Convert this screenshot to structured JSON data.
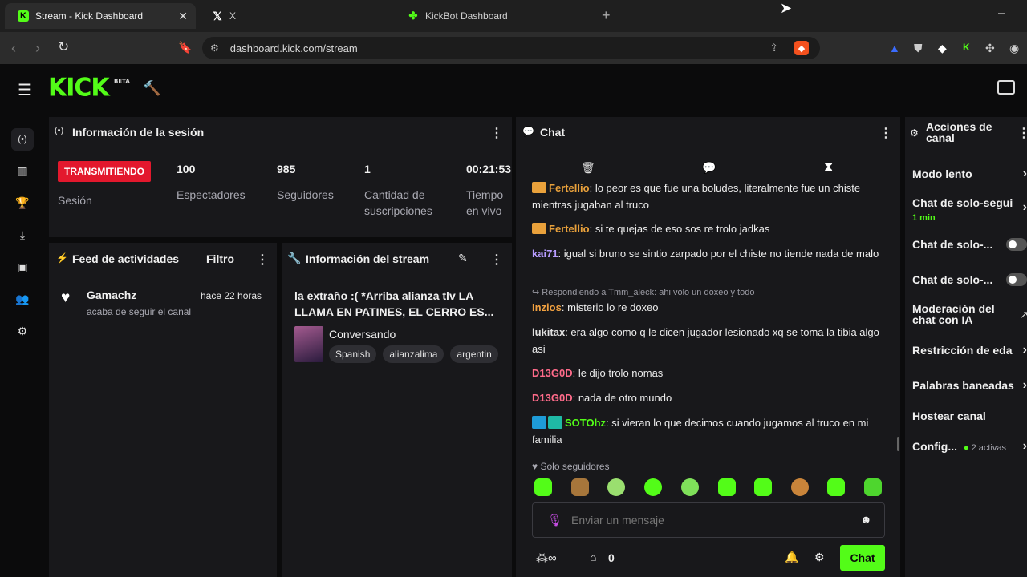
{
  "browser": {
    "tabs": [
      {
        "title": "Stream - Kick Dashboard",
        "icon": "kick-favicon"
      },
      {
        "title": "X",
        "icon": "x-favicon"
      },
      {
        "title": "KickBot Dashboard",
        "icon": "kickbot-favicon"
      }
    ],
    "new_tab": "+",
    "url": "dashboard.kick.com/stream",
    "minimize": "–"
  },
  "app": {
    "logo": "KICK",
    "logo_badge": "BETA"
  },
  "session": {
    "title": "Información de la sesión",
    "status_badge": "TRANSMITIENDO",
    "status_label": "Sesión",
    "stats": [
      {
        "value": "100",
        "label": "Espectadores"
      },
      {
        "value": "985",
        "label": "Seguidores"
      },
      {
        "value": "1",
        "label": "Cantidad de suscripciones"
      },
      {
        "value": "00:21:53",
        "label": "Tiempo en vivo"
      }
    ]
  },
  "feed": {
    "title": "Feed de actividades",
    "filter": "Filtro",
    "items": [
      {
        "user": "Gamachz",
        "time": "hace 22 horas",
        "text": "acaba de seguir el canal"
      }
    ]
  },
  "stream_info": {
    "title": "Información del stream",
    "stream_title": "la extraño :( *Arriba alianza tlv LA LLAMA EN PATINES, EL CERRO ES...",
    "category": "Conversando",
    "tags": [
      "Spanish",
      "alianzalima",
      "argentin"
    ]
  },
  "chat": {
    "title": "Chat",
    "messages": [
      {
        "user": "Fertellio",
        "color": "#e9a13b",
        "text": "lo peor es que fue una boludes, literalmente fue un chiste mientras jugaban al truco",
        "badge": true
      },
      {
        "user": "Fertellio",
        "color": "#e9a13b",
        "text": "si te quejas de eso sos re trolo jadkas",
        "badge": true
      },
      {
        "user": "kai71",
        "color": "#b79cff",
        "text": "igual si bruno se sintio zarpado por el chiste no tiende nada de malo"
      },
      {
        "reply": "Respondiendo a Tmm_aleck: ahi volo un doxeo y todo",
        "user": "Inzios",
        "color": "#f0a040",
        "text": "misterio lo re doxeo"
      },
      {
        "user": "lukitax",
        "color": "#e0e0e0",
        "text": "era algo como q le dicen jugador lesionado xq se toma la tibia algo asi"
      },
      {
        "user": "D13G0D",
        "color": "#ff6b8a",
        "text": "le dijo trolo nomas"
      },
      {
        "user": "D13G0D",
        "color": "#ff6b8a",
        "text": "nada de otro mundo"
      },
      {
        "user": "SOTOhz",
        "color": "#53fc18",
        "text": "si vieran lo que decimos cuando jugamos al truco en mi familia",
        "badge": true
      }
    ],
    "followers_only": "Solo seguidores",
    "input_placeholder": "Enviar un mensaje",
    "points": "0",
    "send": "Chat"
  },
  "actions": {
    "title": "Acciones de canal",
    "items": [
      {
        "label": "Modo lento"
      },
      {
        "label": "Chat de solo-segui",
        "sub": "1 min"
      },
      {
        "label": "Chat de solo-..."
      },
      {
        "label": "Chat de solo-..."
      },
      {
        "label": "Moderación del chat con IA"
      },
      {
        "label": "Restricción de eda"
      },
      {
        "label": "Palabras baneadas"
      },
      {
        "label": "Hostear canal"
      },
      {
        "label": "Config...",
        "sub": "2 activas"
      }
    ]
  },
  "colors": {
    "accent": "#53fc18",
    "live": "#e3182d",
    "panel": "#18181b"
  }
}
